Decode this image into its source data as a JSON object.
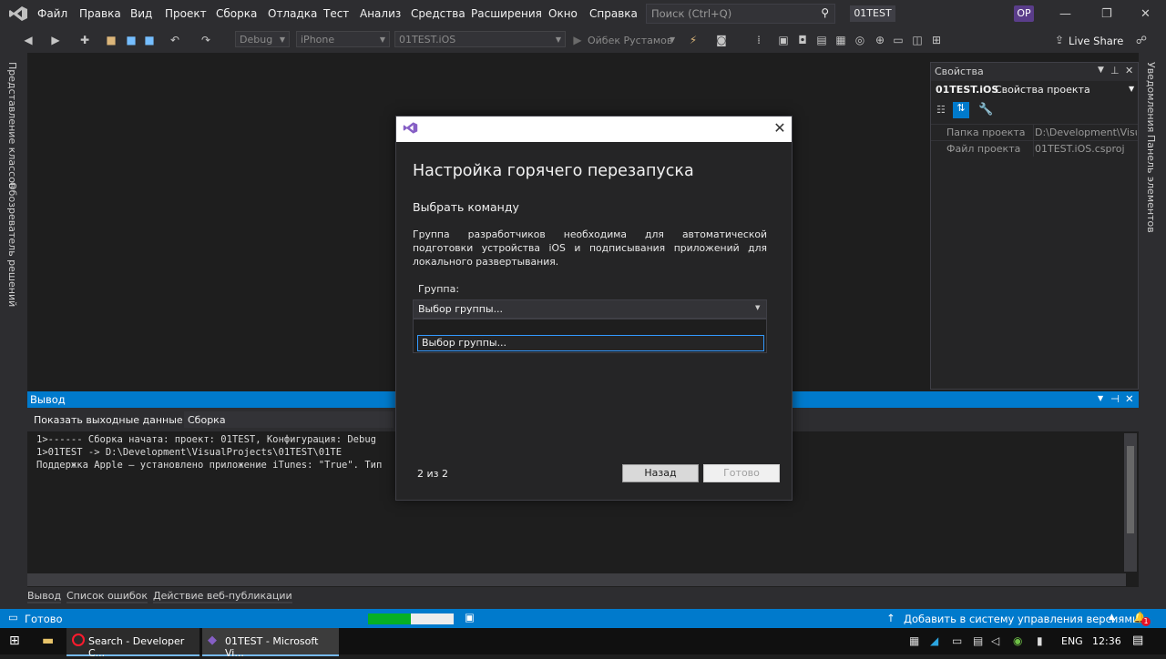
{
  "menu": {
    "items": [
      "Файл",
      "Правка",
      "Вид",
      "Проект",
      "Сборка",
      "Отладка",
      "Тест",
      "Анализ",
      "Средства",
      "Расширения",
      "Окно",
      "Справка"
    ],
    "search_placeholder": "Поиск (Ctrl+Q)",
    "solution_name": "01TEST",
    "avatar": "OP"
  },
  "toolbar": {
    "config": "Debug",
    "platform": "iPhone",
    "startup_project": "01TEST.iOS",
    "run_target": "Ойбек Рустамов",
    "live_share": "Live Share"
  },
  "left_tabs": [
    "Представление классов",
    "Обозреватель решений"
  ],
  "right_tabs": [
    "Уведомления",
    "Панель элементов"
  ],
  "properties": {
    "title": "Свойства",
    "object_name": "01TEST.iOS",
    "object_type": "Свойства проекта",
    "rows": [
      {
        "name": "Папка проекта",
        "value": "D:\\Development\\Visua"
      },
      {
        "name": "Файл проекта",
        "value": "01TEST.iOS.csproj"
      }
    ]
  },
  "output": {
    "title": "Вывод",
    "show_from_label": "Показать выходные данные из:",
    "show_from_value": "Сборка",
    "lines": [
      "1>------ Сборка начата: проект: 01TEST, Конфигурация: Debug",
      "1>01TEST -> D:\\Development\\VisualProjects\\01TEST\\01TE",
      "Поддержка Apple — установлено приложение iTunes: \"True\". Тип"
    ]
  },
  "bottom_tabs": [
    "Вывод",
    "Список ошибок",
    "Действие веб-публикации"
  ],
  "status": {
    "left": "Готово",
    "right": "Добавить в систему управления версиями",
    "notifications_count": "1"
  },
  "taskbar": {
    "apps": [
      {
        "label": "Search - Developer C..."
      },
      {
        "label": "01TEST - Microsoft Vi..."
      }
    ],
    "lang": "ENG",
    "time": "12:36"
  },
  "dialog": {
    "heading": "Настройка горячего перезапуска",
    "subheading": "Выбрать команду",
    "description": "Группа разработчиков необходима для автоматической подготовки устройства iOS и подписывания приложений для локального развертывания.",
    "group_label": "Группа:",
    "group_selected": "Выбор группы...",
    "group_option": "Выбор группы...",
    "step": "2 из 2",
    "back_label": "Назад",
    "done_label": "Готово"
  },
  "colors": {
    "accent": "#007acc",
    "vs_purple": "#865fc5",
    "background": "#1e1e1e"
  }
}
